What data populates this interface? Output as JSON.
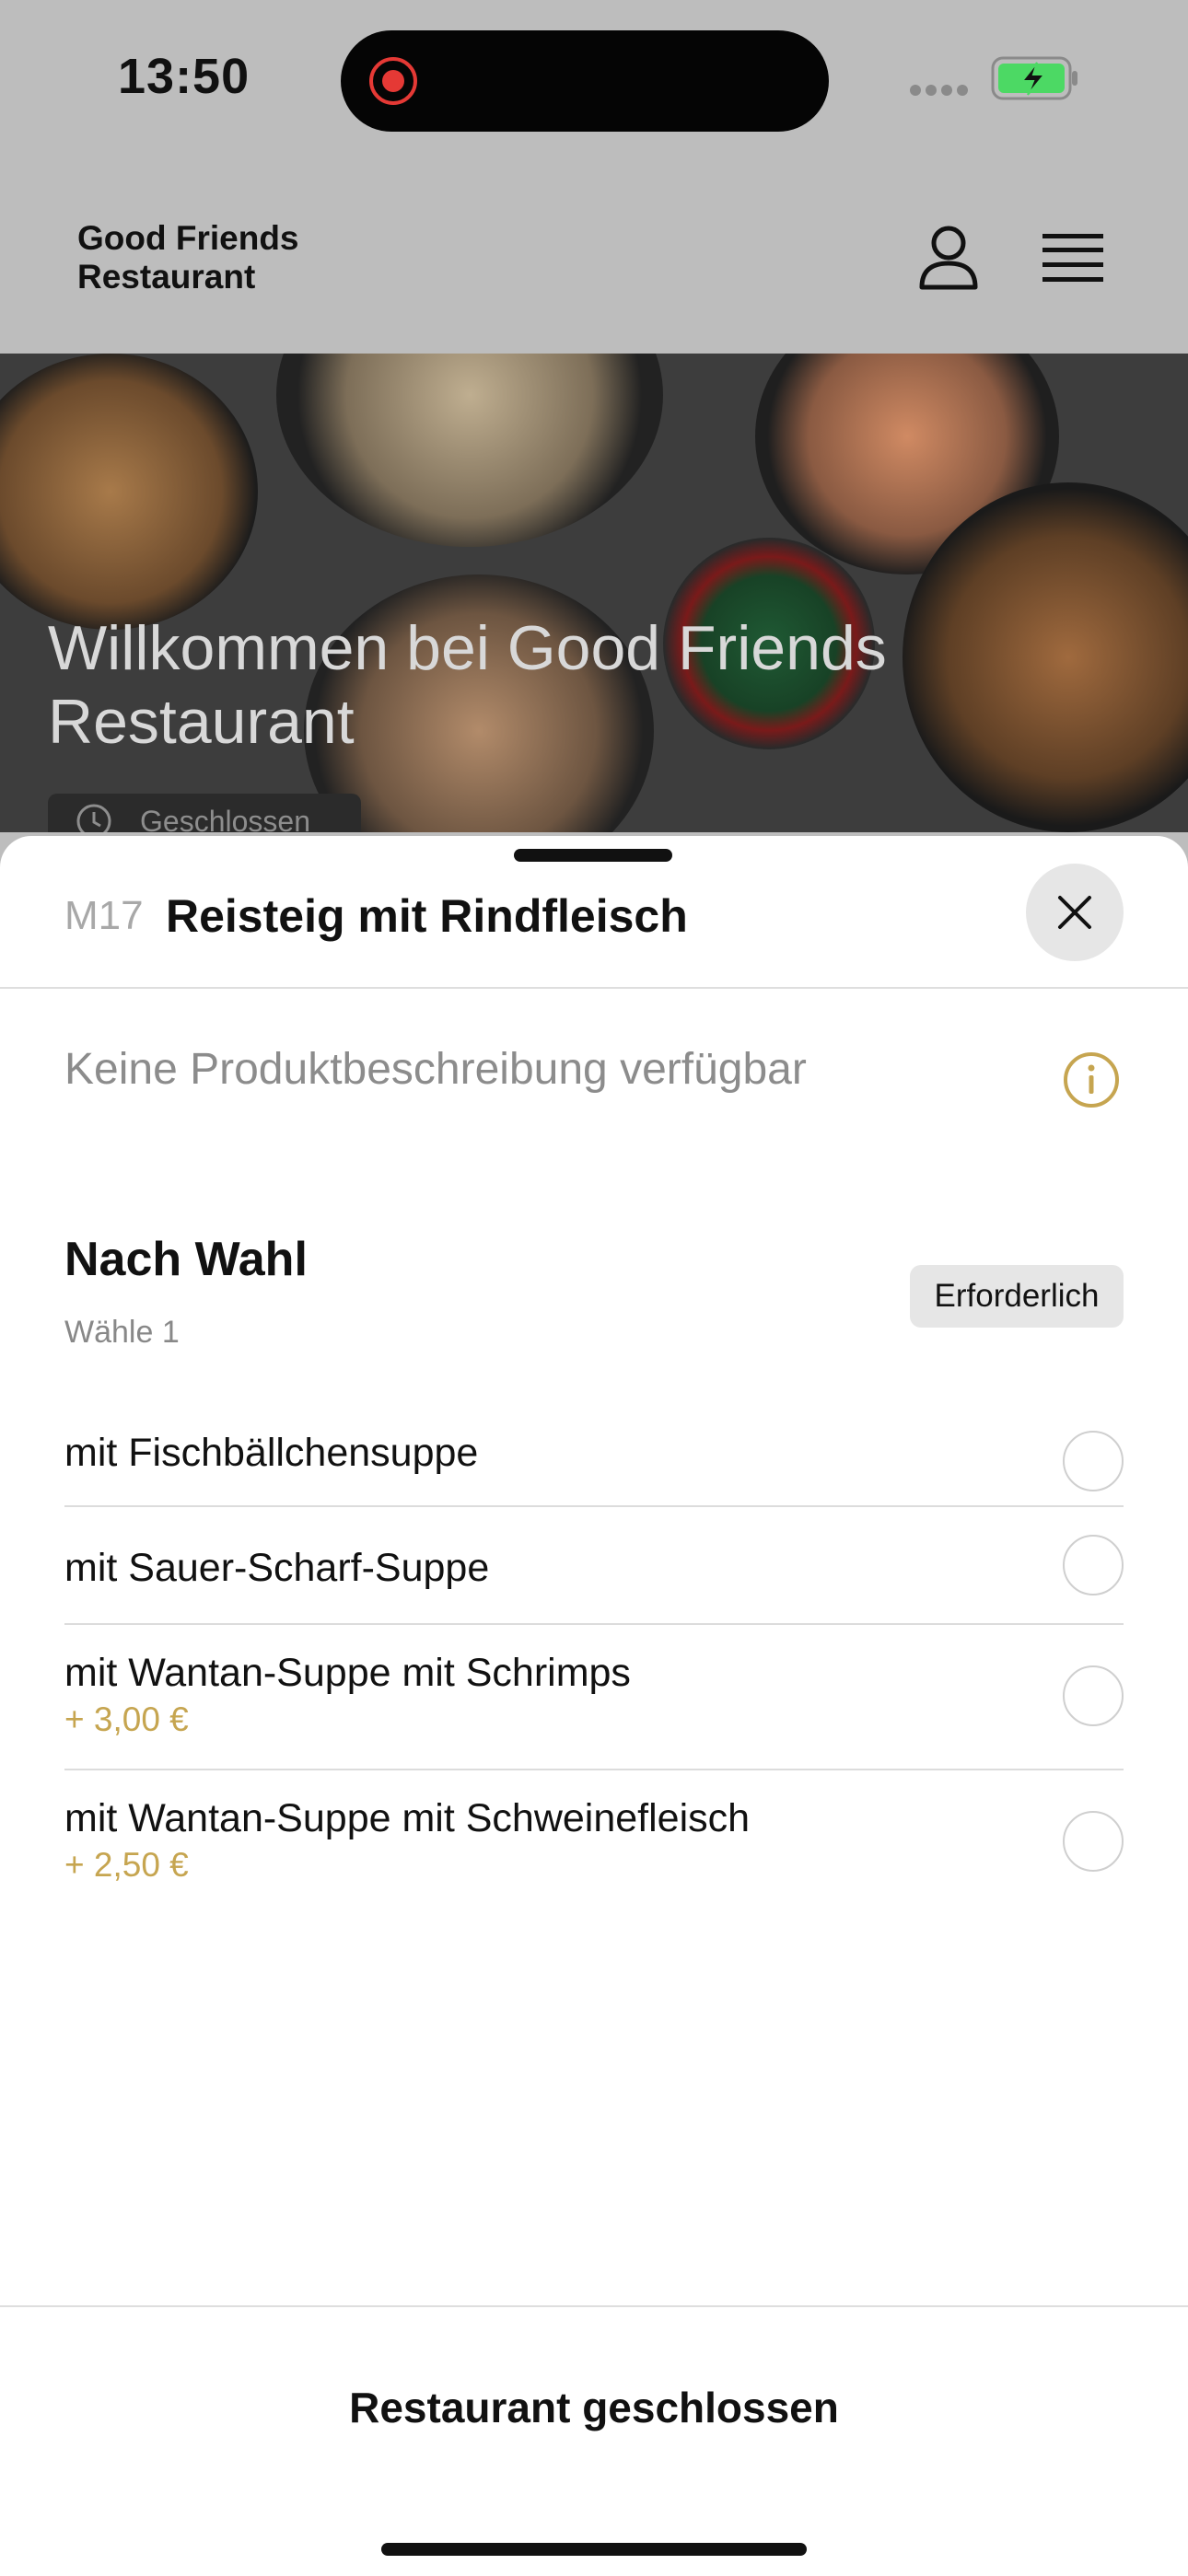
{
  "status_bar": {
    "time": "13:50"
  },
  "header": {
    "brand": "Good Friends Restaurant"
  },
  "hero": {
    "title": "Willkommen bei Good Friends Restaurant",
    "badge": "Geschlossen"
  },
  "sheet": {
    "code": "M17",
    "title": "Reisteig mit Rindfleisch",
    "description": "Keine Produktbeschreibung verfügbar",
    "group": {
      "title": "Nach Wahl",
      "subtitle": "Wähle 1",
      "required": "Erforderlich",
      "options": [
        {
          "label": "mit Fischbällchensuppe",
          "price": ""
        },
        {
          "label": "mit Sauer-Scharf-Suppe",
          "price": ""
        },
        {
          "label": "mit Wantan-Suppe mit Schrimps",
          "price": "+ 3,00 €"
        },
        {
          "label": "mit Wantan-Suppe mit Schweinefleisch",
          "price": "+ 2,50 €"
        }
      ]
    }
  },
  "footer": {
    "closed_label": "Restaurant geschlossen"
  },
  "colors": {
    "accent": "#c6a550",
    "background_dim": "#bdbdbd",
    "record": "#e53935",
    "battery": "#4cd964"
  }
}
